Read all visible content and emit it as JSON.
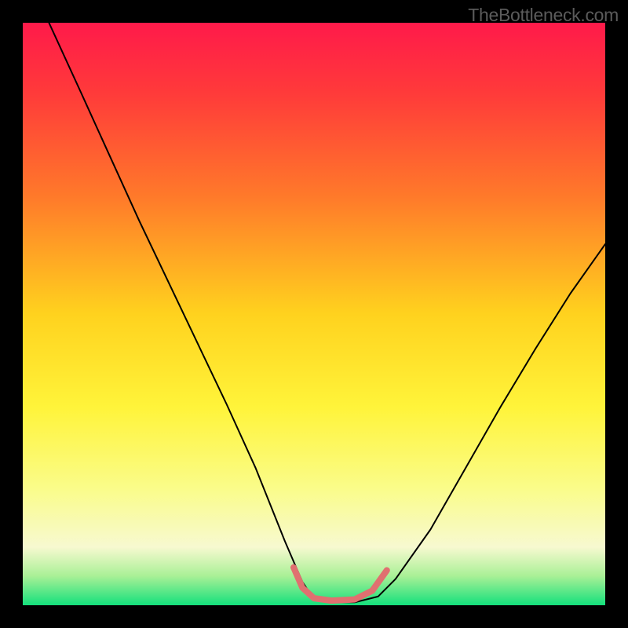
{
  "watermark": "TheBottleneck.com",
  "chart_data": {
    "type": "line",
    "title": "",
    "xlabel": "",
    "ylabel": "",
    "xlim": [
      0,
      1
    ],
    "ylim": [
      0,
      1
    ],
    "background": {
      "type": "vertical-gradient",
      "stops": [
        {
          "offset": 0.0,
          "color": "#ff1a4a"
        },
        {
          "offset": 0.12,
          "color": "#ff3a3a"
        },
        {
          "offset": 0.3,
          "color": "#ff7a2a"
        },
        {
          "offset": 0.5,
          "color": "#ffd21e"
        },
        {
          "offset": 0.66,
          "color": "#fff43a"
        },
        {
          "offset": 0.8,
          "color": "#fafc8a"
        },
        {
          "offset": 0.9,
          "color": "#f7f9d0"
        },
        {
          "offset": 0.95,
          "color": "#a9f096"
        },
        {
          "offset": 1.0,
          "color": "#14e07c"
        }
      ]
    },
    "series": [
      {
        "name": "bottleneck-curve",
        "color": "#000000",
        "width": 2,
        "x": [
          0.045,
          0.1,
          0.15,
          0.2,
          0.25,
          0.3,
          0.35,
          0.4,
          0.45,
          0.48,
          0.5,
          0.53,
          0.57,
          0.61,
          0.64,
          0.7,
          0.76,
          0.82,
          0.88,
          0.94,
          1.0
        ],
        "y": [
          1.0,
          0.88,
          0.77,
          0.66,
          0.555,
          0.45,
          0.345,
          0.235,
          0.11,
          0.04,
          0.01,
          0.005,
          0.005,
          0.015,
          0.045,
          0.13,
          0.235,
          0.34,
          0.44,
          0.535,
          0.62
        ]
      },
      {
        "name": "optimal-zone-highlight",
        "color": "#e07070",
        "width": 8,
        "x": [
          0.465,
          0.48,
          0.5,
          0.53,
          0.57,
          0.6,
          0.625
        ],
        "y": [
          0.065,
          0.03,
          0.012,
          0.008,
          0.01,
          0.025,
          0.06
        ]
      }
    ]
  }
}
